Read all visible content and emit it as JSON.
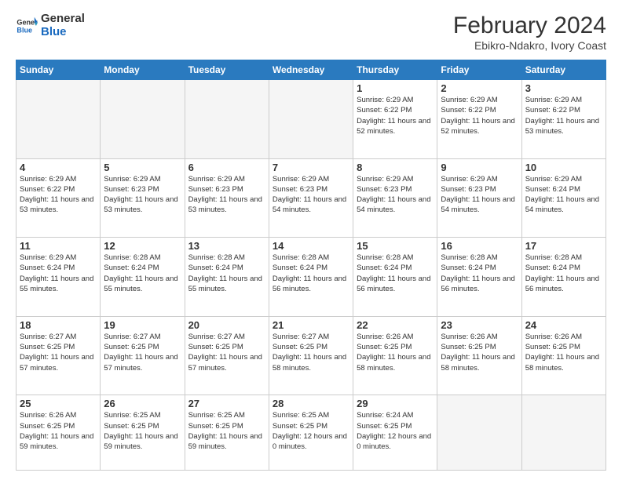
{
  "logo": {
    "line1": "General",
    "line2": "Blue"
  },
  "header": {
    "month_year": "February 2024",
    "location": "Ebikro-Ndakro, Ivory Coast"
  },
  "days_of_week": [
    "Sunday",
    "Monday",
    "Tuesday",
    "Wednesday",
    "Thursday",
    "Friday",
    "Saturday"
  ],
  "weeks": [
    [
      {
        "day": "",
        "info": ""
      },
      {
        "day": "",
        "info": ""
      },
      {
        "day": "",
        "info": ""
      },
      {
        "day": "",
        "info": ""
      },
      {
        "day": "1",
        "info": "Sunrise: 6:29 AM\nSunset: 6:22 PM\nDaylight: 11 hours\nand 52 minutes."
      },
      {
        "day": "2",
        "info": "Sunrise: 6:29 AM\nSunset: 6:22 PM\nDaylight: 11 hours\nand 52 minutes."
      },
      {
        "day": "3",
        "info": "Sunrise: 6:29 AM\nSunset: 6:22 PM\nDaylight: 11 hours\nand 53 minutes."
      }
    ],
    [
      {
        "day": "4",
        "info": "Sunrise: 6:29 AM\nSunset: 6:22 PM\nDaylight: 11 hours\nand 53 minutes."
      },
      {
        "day": "5",
        "info": "Sunrise: 6:29 AM\nSunset: 6:23 PM\nDaylight: 11 hours\nand 53 minutes."
      },
      {
        "day": "6",
        "info": "Sunrise: 6:29 AM\nSunset: 6:23 PM\nDaylight: 11 hours\nand 53 minutes."
      },
      {
        "day": "7",
        "info": "Sunrise: 6:29 AM\nSunset: 6:23 PM\nDaylight: 11 hours\nand 54 minutes."
      },
      {
        "day": "8",
        "info": "Sunrise: 6:29 AM\nSunset: 6:23 PM\nDaylight: 11 hours\nand 54 minutes."
      },
      {
        "day": "9",
        "info": "Sunrise: 6:29 AM\nSunset: 6:23 PM\nDaylight: 11 hours\nand 54 minutes."
      },
      {
        "day": "10",
        "info": "Sunrise: 6:29 AM\nSunset: 6:24 PM\nDaylight: 11 hours\nand 54 minutes."
      }
    ],
    [
      {
        "day": "11",
        "info": "Sunrise: 6:29 AM\nSunset: 6:24 PM\nDaylight: 11 hours\nand 55 minutes."
      },
      {
        "day": "12",
        "info": "Sunrise: 6:28 AM\nSunset: 6:24 PM\nDaylight: 11 hours\nand 55 minutes."
      },
      {
        "day": "13",
        "info": "Sunrise: 6:28 AM\nSunset: 6:24 PM\nDaylight: 11 hours\nand 55 minutes."
      },
      {
        "day": "14",
        "info": "Sunrise: 6:28 AM\nSunset: 6:24 PM\nDaylight: 11 hours\nand 56 minutes."
      },
      {
        "day": "15",
        "info": "Sunrise: 6:28 AM\nSunset: 6:24 PM\nDaylight: 11 hours\nand 56 minutes."
      },
      {
        "day": "16",
        "info": "Sunrise: 6:28 AM\nSunset: 6:24 PM\nDaylight: 11 hours\nand 56 minutes."
      },
      {
        "day": "17",
        "info": "Sunrise: 6:28 AM\nSunset: 6:24 PM\nDaylight: 11 hours\nand 56 minutes."
      }
    ],
    [
      {
        "day": "18",
        "info": "Sunrise: 6:27 AM\nSunset: 6:25 PM\nDaylight: 11 hours\nand 57 minutes."
      },
      {
        "day": "19",
        "info": "Sunrise: 6:27 AM\nSunset: 6:25 PM\nDaylight: 11 hours\nand 57 minutes."
      },
      {
        "day": "20",
        "info": "Sunrise: 6:27 AM\nSunset: 6:25 PM\nDaylight: 11 hours\nand 57 minutes."
      },
      {
        "day": "21",
        "info": "Sunrise: 6:27 AM\nSunset: 6:25 PM\nDaylight: 11 hours\nand 58 minutes."
      },
      {
        "day": "22",
        "info": "Sunrise: 6:26 AM\nSunset: 6:25 PM\nDaylight: 11 hours\nand 58 minutes."
      },
      {
        "day": "23",
        "info": "Sunrise: 6:26 AM\nSunset: 6:25 PM\nDaylight: 11 hours\nand 58 minutes."
      },
      {
        "day": "24",
        "info": "Sunrise: 6:26 AM\nSunset: 6:25 PM\nDaylight: 11 hours\nand 58 minutes."
      }
    ],
    [
      {
        "day": "25",
        "info": "Sunrise: 6:26 AM\nSunset: 6:25 PM\nDaylight: 11 hours\nand 59 minutes."
      },
      {
        "day": "26",
        "info": "Sunrise: 6:25 AM\nSunset: 6:25 PM\nDaylight: 11 hours\nand 59 minutes."
      },
      {
        "day": "27",
        "info": "Sunrise: 6:25 AM\nSunset: 6:25 PM\nDaylight: 11 hours\nand 59 minutes."
      },
      {
        "day": "28",
        "info": "Sunrise: 6:25 AM\nSunset: 6:25 PM\nDaylight: 12 hours\nand 0 minutes."
      },
      {
        "day": "29",
        "info": "Sunrise: 6:24 AM\nSunset: 6:25 PM\nDaylight: 12 hours\nand 0 minutes."
      },
      {
        "day": "",
        "info": ""
      },
      {
        "day": "",
        "info": ""
      }
    ]
  ]
}
